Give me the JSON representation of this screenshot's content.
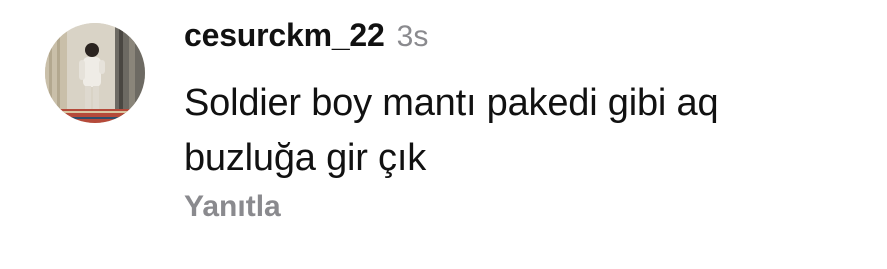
{
  "comment": {
    "username": "cesurckm_22",
    "timestamp": "3s",
    "text_lines": [
      "Soldier boy mantı pakedi gibi aq",
      "buzluğa gir çık"
    ],
    "reply_label": "Yanıtla",
    "avatar_icon": "user-avatar-photo"
  },
  "colors": {
    "text": "#111111",
    "muted": "#8a8a8e",
    "background": "#ffffff"
  }
}
